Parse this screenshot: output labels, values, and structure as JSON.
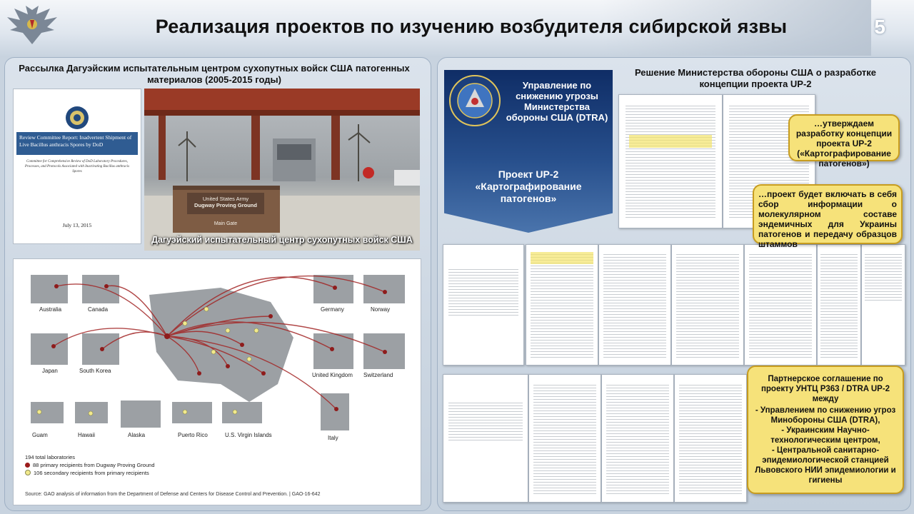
{
  "header": {
    "title": "Реализация проектов по изучению возбудителя сибирской язвы",
    "page": "5"
  },
  "left": {
    "title": "Рассылка Дагуэйским испытательным центром сухопутных войск США патогенных материалов (2005-2015 годы)",
    "report": {
      "title": "Review Committee Report: Inadvertent Shipment of Live Bacillus anthracis Spores by DoD",
      "subtitle": "Committee for Comprehensive Review of DoD Laboratory Procedures, Processes, and Protocols Associated with Inactivating Bacillus anthracis Spores",
      "date": "July 13, 2015"
    },
    "photo": {
      "sign_line1": "United States Army",
      "sign_line2": "Dugway Proving Ground",
      "sign_line3": "Main Gate",
      "caption": "Дагуэйский испытательный центр сухопутных войск США"
    },
    "map": {
      "places": [
        "Australia",
        "Canada",
        "Germany",
        "Norway",
        "Japan",
        "South Korea",
        "United Kingdom",
        "Switzerland",
        "Guam",
        "Hawaii",
        "Alaska",
        "Puerto Rico",
        "U.S. Virgin Islands",
        "Italy"
      ],
      "legend": [
        "194 total laboratories",
        "88 primary recipients from Dugway Proving Ground",
        "106 secondary recipients from primary recipients"
      ],
      "source": "Source: GAO analysis of information from the Department of Defense and Centers for Disease Control and Prevention.  |  GAO-16-642",
      "colors": {
        "primary": "#9b1b1b",
        "secondary": "#f2ea8c"
      }
    }
  },
  "right": {
    "dtra": {
      "heading": "Управление по снижению угрозы Министерства обороны США (DTRA)",
      "project": "Проект UP-2 «Картографирование патогенов»"
    },
    "title": "Решение Министерства обороны США о разработке концепции проекта UP-2",
    "callouts": {
      "c1": "…утверждаем разработку концепции проекта UP-2 («Картографирование патогенов»)",
      "c2": "…проект будет включать в себя сбор информации о молекулярном составе эндемичных для Украины патогенов и передачу образцов штаммов",
      "c3_title": "Партнерское соглашение по проекту УНТЦ Р363 / DTRA UP-2 между",
      "c3_items": [
        "- Управлением по снижению угроз Минобороны США (DTRA),",
        "- Украинским Научно-технологическим центром,",
        "- Центральной санитарно-эпидемиологической станцией Львовского НИИ эпидемиологии и гигиены"
      ]
    }
  }
}
